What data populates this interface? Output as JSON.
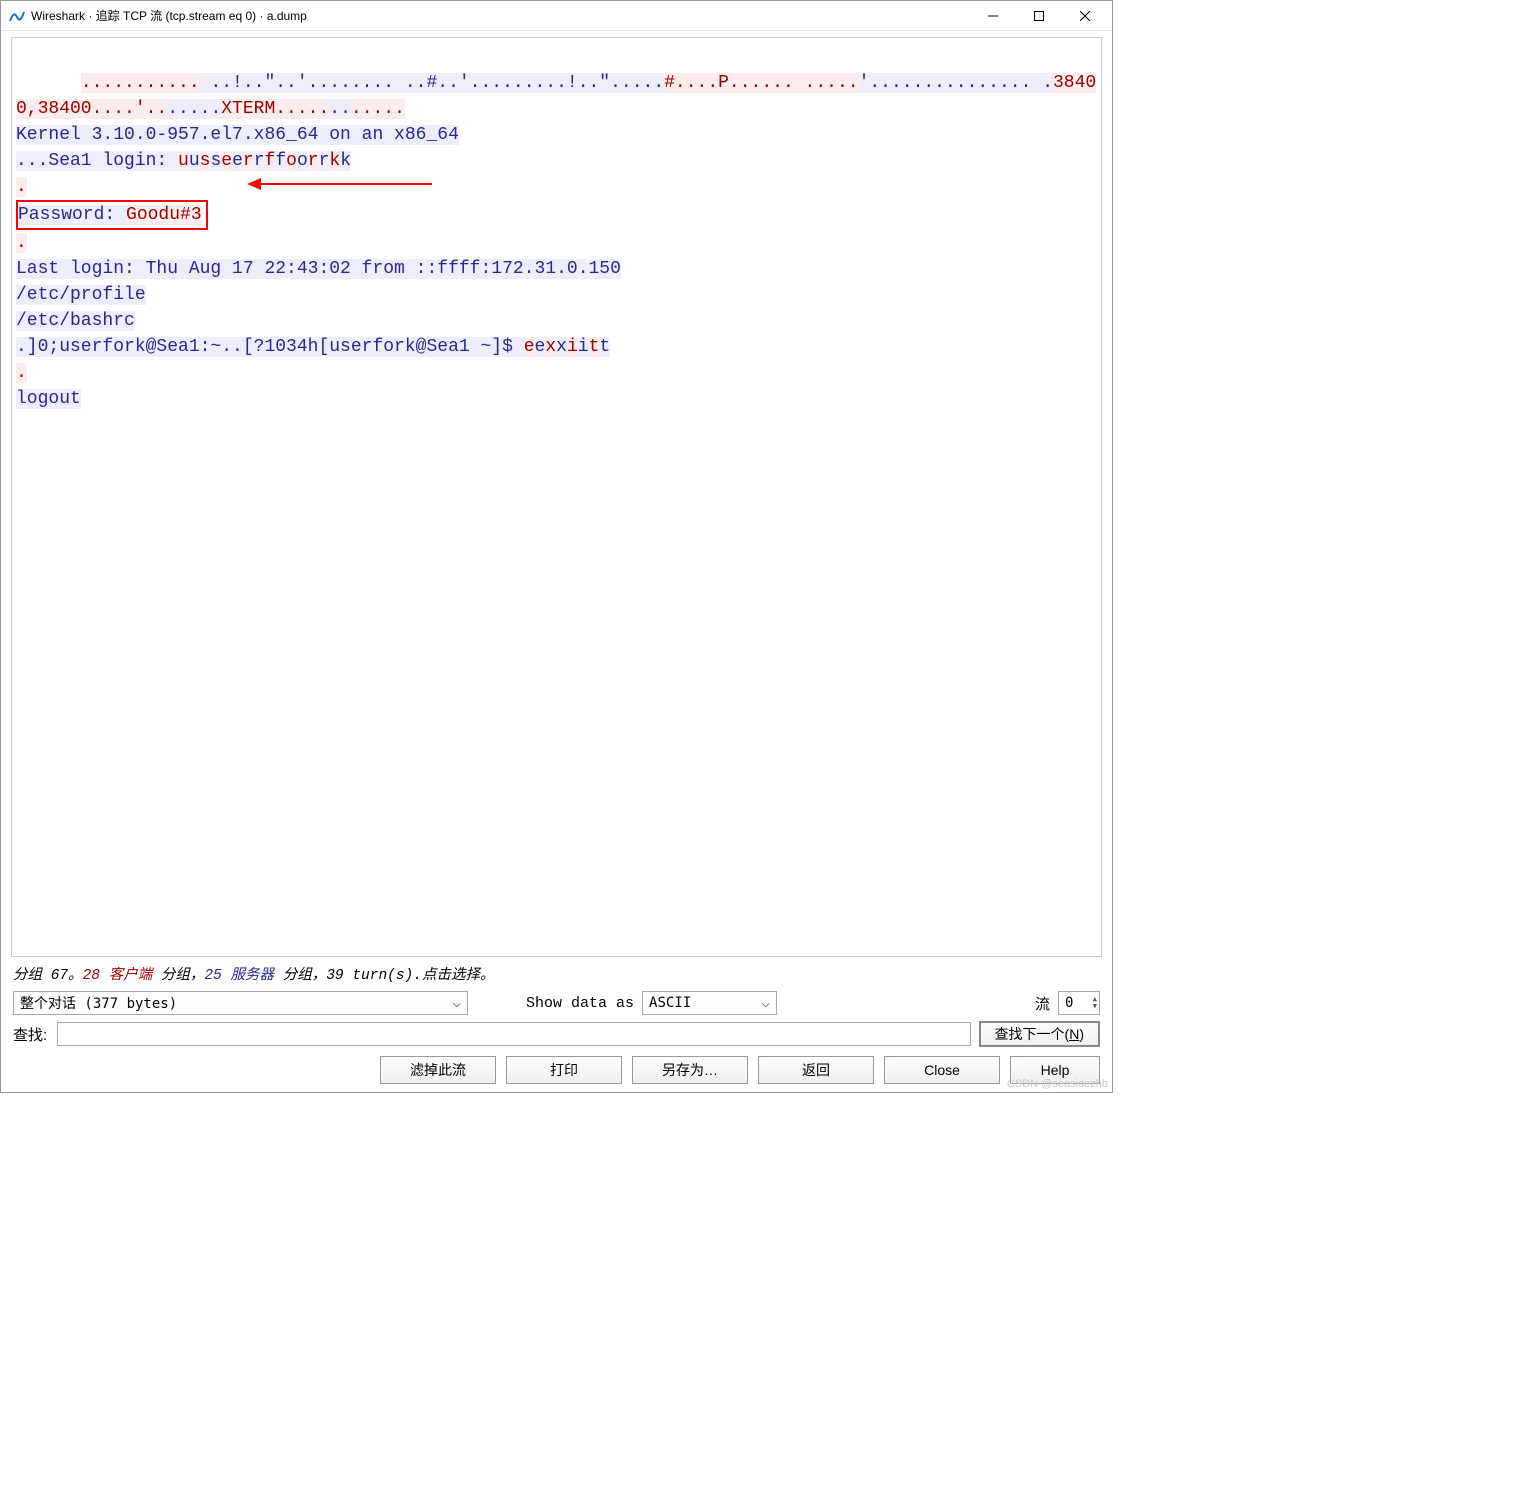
{
  "title": "Wireshark · 追踪 TCP 流 (tcp.stream eq 0) · a.dump",
  "stream": {
    "segments": [
      {
        "t": "c",
        "v": "..........."
      },
      {
        "t": "s",
        "v": " ..!..\"..'........ ..#..'.........!..\"....."
      },
      {
        "t": "c",
        "v": "#....P...... ....."
      },
      {
        "t": "s",
        "v": "'............... ."
      },
      {
        "t": "c",
        "v": "38400,38400....'.."
      },
      {
        "t": "s",
        "v": "....."
      },
      {
        "t": "c",
        "v": "XTERM....."
      },
      {
        "t": "s",
        "v": ".."
      },
      {
        "t": "c",
        "v": "....."
      },
      {
        "t": "s",
        "v": "\nKernel 3.10.0-957.el7.x86_64 on an x86_64\n..."
      },
      {
        "t": "s",
        "v": "Sea1 login: "
      },
      {
        "t": "c",
        "v": "u"
      },
      {
        "t": "s",
        "v": "u"
      },
      {
        "t": "c",
        "v": "s"
      },
      {
        "t": "s",
        "v": "s"
      },
      {
        "t": "c",
        "v": "e"
      },
      {
        "t": "s",
        "v": "e"
      },
      {
        "t": "c",
        "v": "r"
      },
      {
        "t": "s",
        "v": "r"
      },
      {
        "t": "c",
        "v": "f"
      },
      {
        "t": "s",
        "v": "f"
      },
      {
        "t": "c",
        "v": "o"
      },
      {
        "t": "s",
        "v": "o"
      },
      {
        "t": "c",
        "v": "r"
      },
      {
        "t": "s",
        "v": "r"
      },
      {
        "t": "c",
        "v": "k"
      },
      {
        "t": "s",
        "v": "k"
      },
      {
        "t": "c",
        "v": "\n."
      },
      {
        "t": "s",
        "v": "\n"
      },
      {
        "t": "box",
        "v": "Password: "
      },
      {
        "t": "boxc",
        "v": "Goodu#3"
      },
      {
        "t": "c",
        "v": "\n."
      },
      {
        "t": "s",
        "v": "\nLast login: Thu Aug 17 22:43:02 from ::ffff:172.31.0.150"
      },
      {
        "t": "s",
        "v": "\n/etc/profile\n/etc/bashrc\n.]0;userfork@Sea1:~..[?1034h[userfork@Sea1 ~]$ "
      },
      {
        "t": "c",
        "v": "e"
      },
      {
        "t": "s",
        "v": "e"
      },
      {
        "t": "c",
        "v": "x"
      },
      {
        "t": "s",
        "v": "x"
      },
      {
        "t": "c",
        "v": "i"
      },
      {
        "t": "s",
        "v": "i"
      },
      {
        "t": "c",
        "v": "t"
      },
      {
        "t": "s",
        "v": "t"
      },
      {
        "t": "c",
        "v": "\n."
      },
      {
        "t": "s",
        "v": "\nlogout"
      }
    ]
  },
  "summary": {
    "pkts_label_pre": "分组 67。",
    "client_pkts": "28 客户端",
    "mid1": " 分组，",
    "server_pkts": "25 服务器",
    "mid2": " 分组，",
    "turns": "39 turn(s).",
    "click": "点击选择。"
  },
  "conversation_combo": "整个对话 (377 bytes)",
  "show_as_label": "Show data as",
  "format_combo": "ASCII",
  "stream_label": "流",
  "stream_num": "0",
  "find_label": "查找:",
  "find_value": "",
  "buttons": {
    "find_next": "查找下一个(N)",
    "filter_out": "滤掉此流",
    "print": "打印",
    "save_as": "另存为…",
    "back": "返回",
    "close": "Close",
    "help": "Help"
  },
  "watermark": "CSDN @seasidezhb"
}
